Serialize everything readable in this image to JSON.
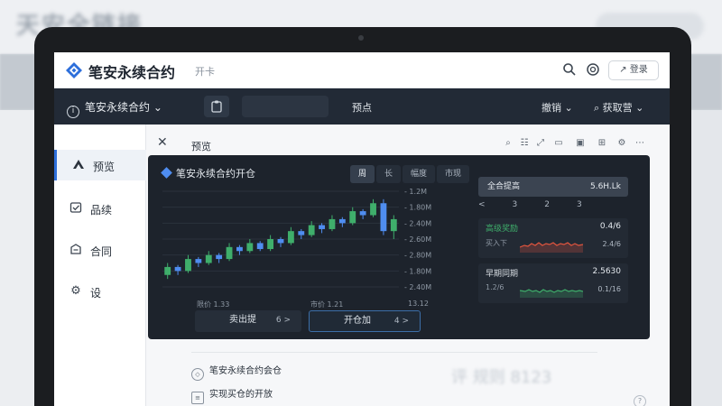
{
  "background": {
    "title": "天安全链接"
  },
  "header": {
    "app_title": "笔安永续合约",
    "app_subtitle": "开卡",
    "login_button": "登录"
  },
  "navbar": {
    "brand": "笔安永续合约",
    "center_item": "预点",
    "right_item_1": "撤销",
    "right_item_2": "获取营"
  },
  "sidebar": {
    "items": [
      {
        "icon": "chevron-up-icon",
        "label": "预览"
      },
      {
        "icon": "checkbox-icon",
        "label": "品续"
      },
      {
        "icon": "contract-icon",
        "label": "合同"
      },
      {
        "icon": "gear-icon",
        "label": "设"
      }
    ]
  },
  "content": {
    "title": "预览"
  },
  "panel": {
    "title": "笔安永续合约开仓",
    "segments": [
      "周",
      "长",
      "幅度",
      "市现"
    ],
    "vol_labels": [
      "限价 1.33",
      "市价 1.21",
      "13.12"
    ],
    "buttons": [
      {
        "label": "卖出提",
        "arrow": "6 >"
      },
      {
        "label": "开仓加",
        "arrow": "4 >"
      }
    ],
    "stat_top": {
      "label": "全合提高",
      "value": "5.6H.Lk"
    },
    "stat_tabs": [
      "<",
      "3",
      "2",
      "3"
    ],
    "cards": [
      {
        "title": "高级奖励",
        "value": "0.4/6",
        "sub": "买入下",
        "sub_value": "2.4/6"
      },
      {
        "title": "早期同期",
        "value": "2.5630",
        "sub": "1.2/6",
        "sub_value": "0.1/16"
      }
    ]
  },
  "chart_data": {
    "type": "candlestick",
    "y_ticks": [
      "1.2M",
      "1.80M",
      "2.40M",
      "2.60M",
      "2.80M",
      "1.80M",
      "2.40M"
    ],
    "candles": [
      {
        "o": 2.1,
        "c": 2.3,
        "h": 2.4,
        "l": 2.0
      },
      {
        "o": 2.3,
        "c": 2.2,
        "h": 2.35,
        "l": 2.1
      },
      {
        "o": 2.2,
        "c": 2.5,
        "h": 2.6,
        "l": 2.15
      },
      {
        "o": 2.5,
        "c": 2.4,
        "h": 2.55,
        "l": 2.3
      },
      {
        "o": 2.4,
        "c": 2.6,
        "h": 2.7,
        "l": 2.35
      },
      {
        "o": 2.6,
        "c": 2.5,
        "h": 2.65,
        "l": 2.4
      },
      {
        "o": 2.5,
        "c": 2.8,
        "h": 2.9,
        "l": 2.45
      },
      {
        "o": 2.8,
        "c": 2.7,
        "h": 2.85,
        "l": 2.6
      },
      {
        "o": 2.7,
        "c": 2.9,
        "h": 3.0,
        "l": 2.65
      },
      {
        "o": 2.9,
        "c": 2.75,
        "h": 2.95,
        "l": 2.7
      },
      {
        "o": 2.75,
        "c": 3.0,
        "h": 3.1,
        "l": 2.7
      },
      {
        "o": 3.0,
        "c": 2.9,
        "h": 3.05,
        "l": 2.8
      },
      {
        "o": 2.9,
        "c": 3.2,
        "h": 3.3,
        "l": 2.85
      },
      {
        "o": 3.2,
        "c": 3.1,
        "h": 3.25,
        "l": 3.0
      },
      {
        "o": 3.1,
        "c": 3.35,
        "h": 3.45,
        "l": 3.05
      },
      {
        "o": 3.35,
        "c": 3.25,
        "h": 3.4,
        "l": 3.15
      },
      {
        "o": 3.25,
        "c": 3.5,
        "h": 3.6,
        "l": 3.2
      },
      {
        "o": 3.5,
        "c": 3.4,
        "h": 3.55,
        "l": 3.3
      },
      {
        "o": 3.4,
        "c": 3.7,
        "h": 3.8,
        "l": 3.35
      },
      {
        "o": 3.7,
        "c": 3.6,
        "h": 3.75,
        "l": 3.5
      },
      {
        "o": 3.6,
        "c": 3.9,
        "h": 4.0,
        "l": 3.55
      },
      {
        "o": 3.9,
        "c": 3.2,
        "h": 4.0,
        "l": 3.1
      },
      {
        "o": 3.2,
        "c": 3.5,
        "h": 3.6,
        "l": 3.0
      }
    ],
    "ylim": [
      1.8,
      4.2
    ],
    "up_color": "#3fae6b",
    "down_color": "#4f8df0"
  },
  "lower_list": {
    "items": [
      {
        "icon": "shield-icon",
        "label": "笔安永续合约会仓"
      },
      {
        "icon": "document-icon",
        "label": "实现买仓的开放"
      }
    ],
    "ghost": "评 规则 8123"
  },
  "colors": {
    "accent": "#2d6fdb",
    "nav_bg": "#222a36",
    "panel_bg": "#1d232c"
  }
}
